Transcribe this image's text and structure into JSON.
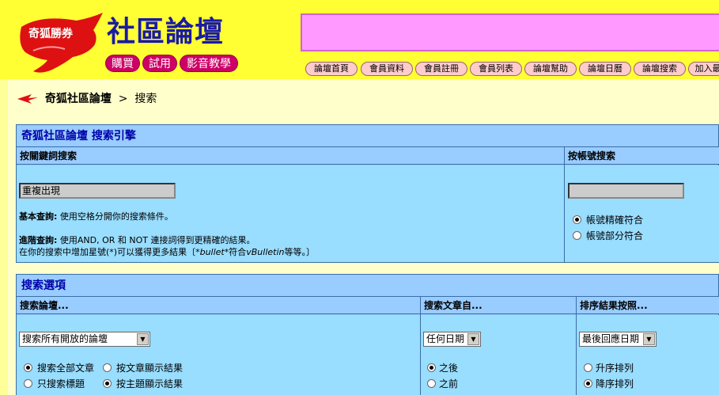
{
  "header": {
    "logo_text": "奇狐勝券",
    "site_title": "社區論壇",
    "top_buttons": [
      "購買",
      "試用",
      "影音教學"
    ],
    "nav": [
      "論壇首頁",
      "會員資料",
      "會員註冊",
      "會員列表",
      "論壇幫助",
      "論壇日曆",
      "論壇搜索",
      "加入最"
    ]
  },
  "breadcrumb": {
    "forum": "奇狐社區論壇",
    "separator": ">",
    "current": "搜索"
  },
  "search_engine": {
    "title": "奇狐社區論壇 搜索引擎",
    "keyword_header": "按關鍵詞搜索",
    "keyword_value": "重複出現",
    "basic_label": "基本查詢:",
    "basic_text": "使用空格分開你的搜索條件。",
    "advanced_label": "進階查詢:",
    "advanced_text": "使用AND, OR 和 NOT 連接詞得到更精確的結果。",
    "wildcard_text_1": "在你的搜索中增加星號(*)可以獲得更多結果〔",
    "wildcard_example": "*bullet*",
    "wildcard_text_2": "符合",
    "wildcard_example_2": "vBulletin",
    "wildcard_text_3": "等等。〕",
    "user_header": "按帳號搜索",
    "user_value": "",
    "user_exact": "帳號精確符合",
    "user_partial": "帳號部分符合"
  },
  "options": {
    "title": "搜索選項",
    "forum_header": "搜索論壇...",
    "forum_select": "搜索所有開放的論壇",
    "all_posts": "搜索全部文章",
    "titles_only": "只搜索標題",
    "show_posts": "按文章顯示結果",
    "show_threads": "按主題顯示結果",
    "date_header": "搜索文章自...",
    "date_select": "任何日期",
    "after": "之後",
    "before": "之前",
    "sort_header": "排序結果按照...",
    "sort_select": "最後回應日期",
    "ascending": "升序排列",
    "descending": "降序排列"
  },
  "colors": {
    "header_bg": "#ffff33",
    "title_blue": "#1a1aa6",
    "panel_bg": "#99ccff",
    "banner_pink": "#ff99ff"
  }
}
